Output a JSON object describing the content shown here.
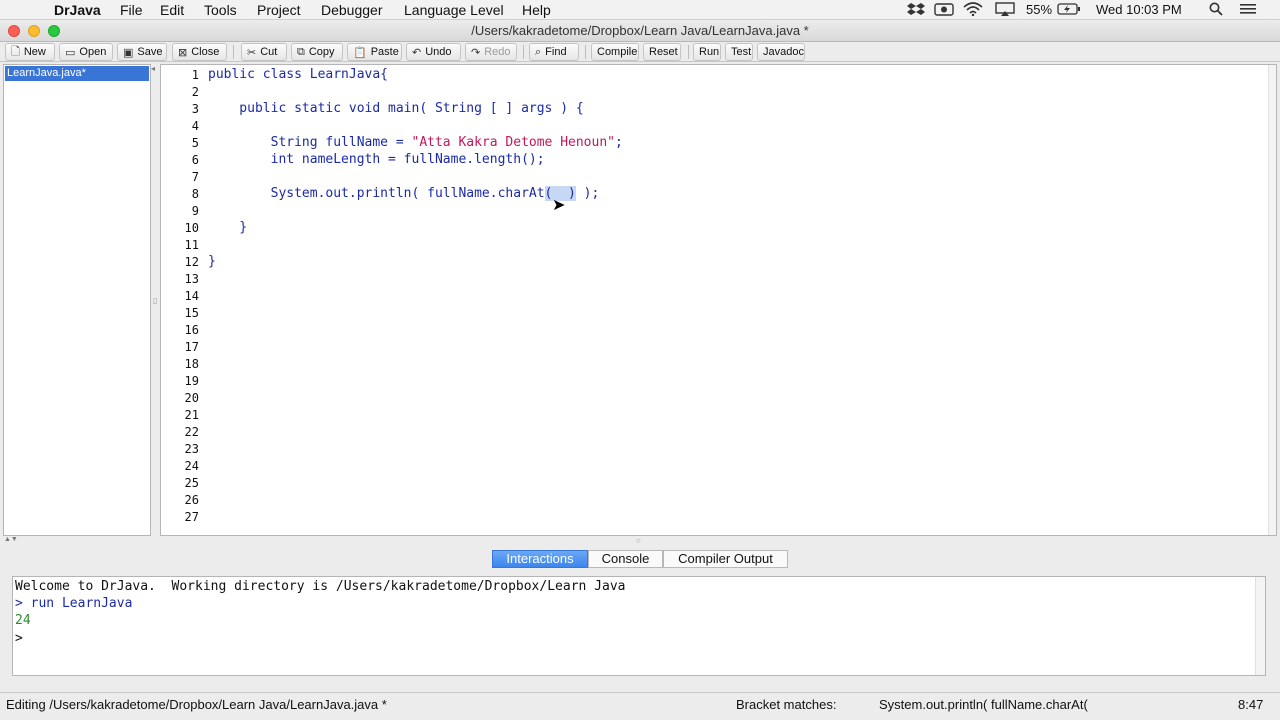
{
  "menubar": {
    "apple_glyph": "",
    "app_name": "DrJava",
    "items": [
      "File",
      "Edit",
      "Tools",
      "Project",
      "Debugger",
      "Language Level",
      "Help"
    ],
    "battery": "55%",
    "clock": "Wed 10:03 PM"
  },
  "window": {
    "title": "/Users/kakradetome/Dropbox/Learn Java/LearnJava.java *"
  },
  "toolbar": {
    "new": "New",
    "open": "Open",
    "save": "Save",
    "close": "Close",
    "cut": "Cut",
    "copy": "Copy",
    "paste": "Paste",
    "undo": "Undo",
    "redo": "Redo",
    "find": "Find",
    "compile": "Compile",
    "reset": "Reset",
    "run": "Run",
    "test": "Test",
    "javadoc": "Javadoc"
  },
  "documents": {
    "items": [
      "LearnJava.java*"
    ]
  },
  "editor": {
    "line_numbers": [
      "1",
      "2",
      "3",
      "4",
      "5",
      "6",
      "7",
      "8",
      "9",
      "10",
      "11",
      "12",
      "13",
      "14",
      "15",
      "16",
      "17",
      "18",
      "19",
      "20",
      "21",
      "22",
      "23",
      "24",
      "25",
      "26",
      "27"
    ],
    "code": {
      "l1": "public class LearnJava{",
      "l3": "    public static void main( String [ ] args ) {",
      "l5_pre": "        String fullName = ",
      "l5_str": "\"Atta Kakra Detome Henoun\"",
      "l5_post": ";",
      "l6": "        int nameLength = fullName.length();",
      "l8_pre": "        System.out.println( fullName.charAt",
      "l8_sel": "(  )",
      "l8_post": " );",
      "l10": "    }",
      "l12": "}"
    }
  },
  "tabs": {
    "interactions": "Interactions",
    "console": "Console",
    "compiler_output": "Compiler Output"
  },
  "interactions": {
    "welcome": "Welcome to DrJava.  Working directory is /Users/kakradetome/Dropbox/Learn Java",
    "command": "> run LearnJava",
    "output": "24",
    "prompt": ">"
  },
  "status": {
    "editing": "Editing /Users/kakradetome/Dropbox/Learn Java/LearnJava.java *",
    "bracket_label": "Bracket matches:",
    "bracket_value": "System.out.println( fullName.charAt(",
    "position": "8:47"
  },
  "colors": {
    "keyword_blue": "#1b2aa8",
    "string_pink": "#c2185b",
    "output_green": "#2e8b2e",
    "selection": "#3875d7"
  }
}
